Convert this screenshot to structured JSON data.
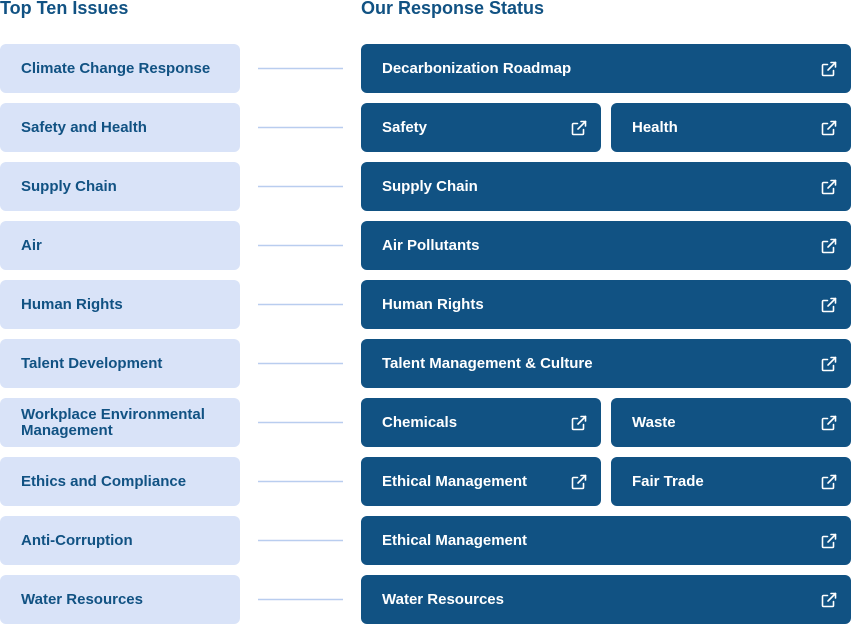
{
  "headings": {
    "issues": "Top Ten Issues",
    "responses": "Our Response Status"
  },
  "colors": {
    "issue_bg": "#d9e3f8",
    "issue_text": "#115283",
    "response_bg": "#115283",
    "response_text": "#ffffff",
    "connector": "#b9cdef"
  },
  "rows": [
    {
      "issue": "Climate Change Response",
      "responses": [
        {
          "label": "Decarbonization Roadmap",
          "icon": "external-link-icon"
        }
      ]
    },
    {
      "issue": "Safety and Health",
      "responses": [
        {
          "label": "Safety",
          "icon": "external-link-icon"
        },
        {
          "label": "Health",
          "icon": "external-link-icon"
        }
      ]
    },
    {
      "issue": "Supply Chain",
      "responses": [
        {
          "label": "Supply Chain",
          "icon": "external-link-icon"
        }
      ]
    },
    {
      "issue": "Air",
      "responses": [
        {
          "label": "Air Pollutants",
          "icon": "external-link-icon"
        }
      ]
    },
    {
      "issue": "Human Rights",
      "responses": [
        {
          "label": "Human Rights",
          "icon": "external-link-icon"
        }
      ]
    },
    {
      "issue": "Talent Development",
      "responses": [
        {
          "label": "Talent Management & Culture",
          "icon": "external-link-icon"
        }
      ]
    },
    {
      "issue": "Workplace Environmental Management",
      "responses": [
        {
          "label": "Chemicals",
          "icon": "external-link-icon"
        },
        {
          "label": "Waste",
          "icon": "external-link-icon"
        }
      ]
    },
    {
      "issue": "Ethics and Compliance",
      "responses": [
        {
          "label": "Ethical Management",
          "icon": "external-link-icon"
        },
        {
          "label": "Fair Trade",
          "icon": "external-link-icon"
        }
      ]
    },
    {
      "issue": "Anti-Corruption",
      "responses": [
        {
          "label": "Ethical Management",
          "icon": "external-link-icon"
        }
      ]
    },
    {
      "issue": "Water Resources",
      "responses": [
        {
          "label": "Water Resources",
          "icon": "external-link-icon"
        }
      ]
    }
  ]
}
